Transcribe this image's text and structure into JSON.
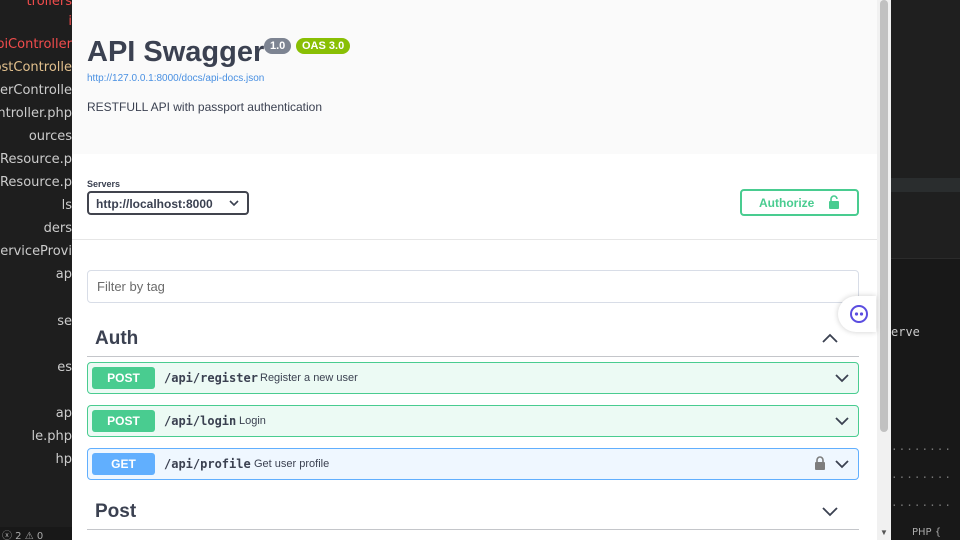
{
  "ide": {
    "file_tree": [
      {
        "label": "trollers",
        "style": "red"
      },
      {
        "label": "i",
        "style": "red"
      },
      {
        "label": "piController",
        "style": "red"
      },
      {
        "label": "ostControlle",
        "style": "orange"
      },
      {
        "label": "serControlle",
        "style": "normal"
      },
      {
        "label": "ntroller.php",
        "style": "normal"
      },
      {
        "label": "ources",
        "style": "normal"
      },
      {
        "label": "stResource.p",
        "style": "normal"
      },
      {
        "label": "erResource.p",
        "style": "normal"
      },
      {
        "label": "ls",
        "style": "normal"
      },
      {
        "label": "ders",
        "style": "normal"
      },
      {
        "label": "ServiceProvi",
        "style": "normal"
      },
      {
        "label": "ap",
        "style": "normal"
      },
      {
        "label": "se",
        "style": "normal"
      },
      {
        "label": "es",
        "style": "normal"
      },
      {
        "label": "ap",
        "style": "normal"
      },
      {
        "label": "le.php",
        "style": "normal"
      },
      {
        "label": "hp",
        "style": "normal"
      }
    ],
    "terminal_text": "erve",
    "terminal_dots": "........",
    "status_left": "ⓧ 2 ⚠ 0",
    "status_right": "PHP  {"
  },
  "swagger": {
    "title": "API Swagger",
    "version_badge": "1.0",
    "oas_badge": "OAS 3.0",
    "docs_url": "http://127.0.0.1:8000/docs/api-docs.json",
    "description": "RESTFULL API with passport authentication",
    "servers_label": "Servers",
    "server_selected": "http://localhost:8000",
    "authorize_label": "Authorize",
    "filter_placeholder": "Filter by tag",
    "tags": [
      {
        "name": "Auth",
        "expanded": true,
        "operations": [
          {
            "method": "POST",
            "path": "/api/register",
            "summary": "Register a new user",
            "locked": false
          },
          {
            "method": "POST",
            "path": "/api/login",
            "summary": "Login",
            "locked": false
          },
          {
            "method": "GET",
            "path": "/api/profile",
            "summary": "Get user profile",
            "locked": true
          }
        ]
      },
      {
        "name": "Post",
        "expanded": false,
        "operations": []
      }
    ]
  },
  "colors": {
    "post": "#49cc90",
    "get": "#61affe",
    "text": "#3b4151",
    "link": "#4990e2",
    "version_badge": "#7d8492",
    "oas_badge": "#89bf04"
  }
}
